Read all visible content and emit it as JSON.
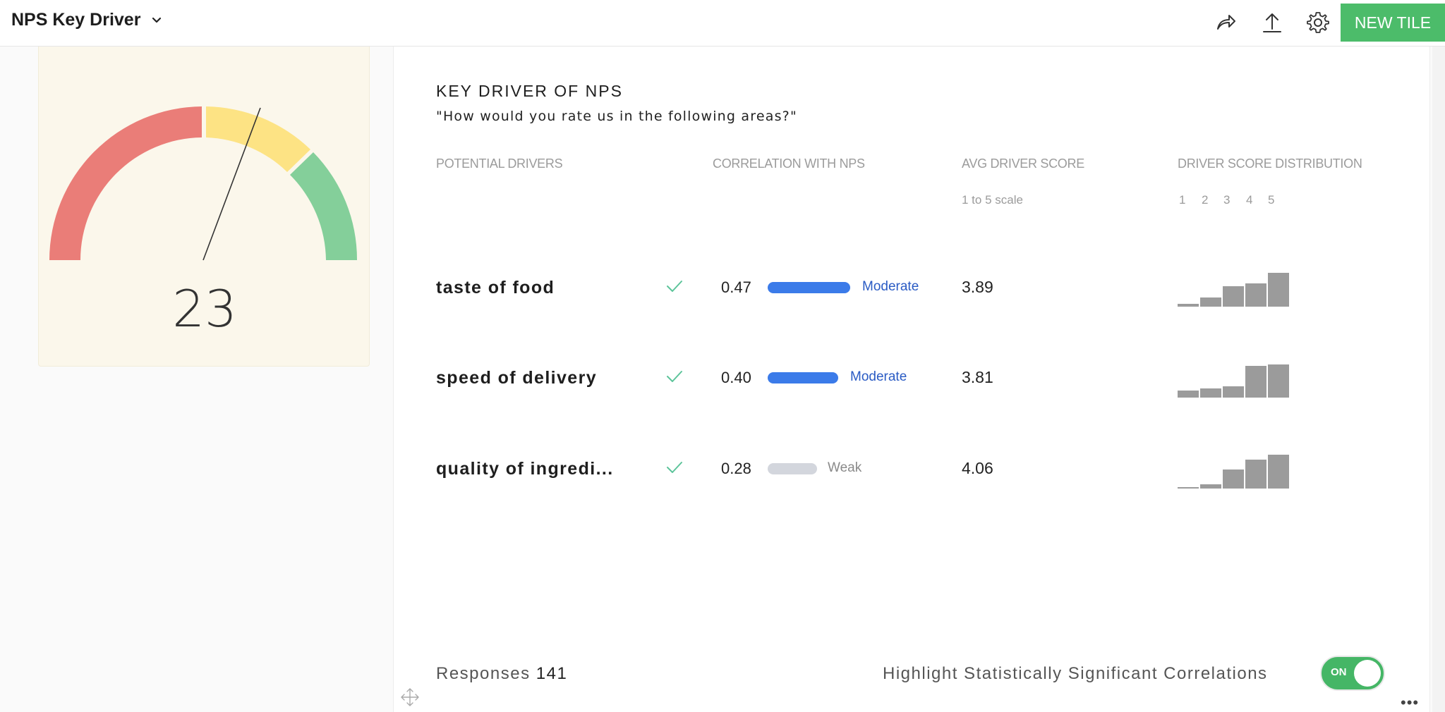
{
  "header": {
    "title": "NPS Key Driver",
    "new_tile_label": "NEW TILE",
    "icons": [
      "share-icon",
      "upload-icon",
      "gear-icon"
    ]
  },
  "gauge": {
    "value": "23",
    "segment_colors": [
      "#ea7d78",
      "#fde384",
      "#84cf9a"
    ]
  },
  "key_driver": {
    "title": "KEY DRIVER OF NPS",
    "subtitle": "\"How would you rate us in the following areas?\"",
    "columns": {
      "drivers": "POTENTIAL DRIVERS",
      "correlation": "CORRELATION WITH NPS",
      "avg_score": "AVG DRIVER SCORE",
      "avg_score_sub": "1 to 5 scale",
      "distribution": "DRIVER SCORE DISTRIBUTION",
      "distribution_scale": [
        "1",
        "2",
        "3",
        "4",
        "5"
      ]
    },
    "rows": [
      {
        "label": "taste of food",
        "correlation": "0.47",
        "strength": "Moderate",
        "avg": "3.89",
        "distribution": [
          0.08,
          0.28,
          0.6,
          0.68,
          1.0
        ]
      },
      {
        "label": "speed of delivery",
        "correlation": "0.40",
        "strength": "Moderate",
        "avg": "3.81",
        "distribution": [
          0.2,
          0.28,
          0.33,
          0.93,
          0.97
        ]
      },
      {
        "label": "quality of ingredi...",
        "correlation": "0.28",
        "strength": "Weak",
        "avg": "4.06",
        "distribution": [
          0.04,
          0.12,
          0.57,
          0.85,
          1.0
        ]
      }
    ],
    "colors": {
      "strong_bar": "#3b7be9",
      "strong_text": "#2a5bc4",
      "weak_bar": "#d3d6dd",
      "weak_text": "#8a8a8a",
      "check": "#5cc49a"
    }
  },
  "footer": {
    "responses_label": "Responses",
    "responses_count": "141",
    "highlight_label": "Highlight Statistically Significant Correlations",
    "toggle_label": "ON"
  }
}
